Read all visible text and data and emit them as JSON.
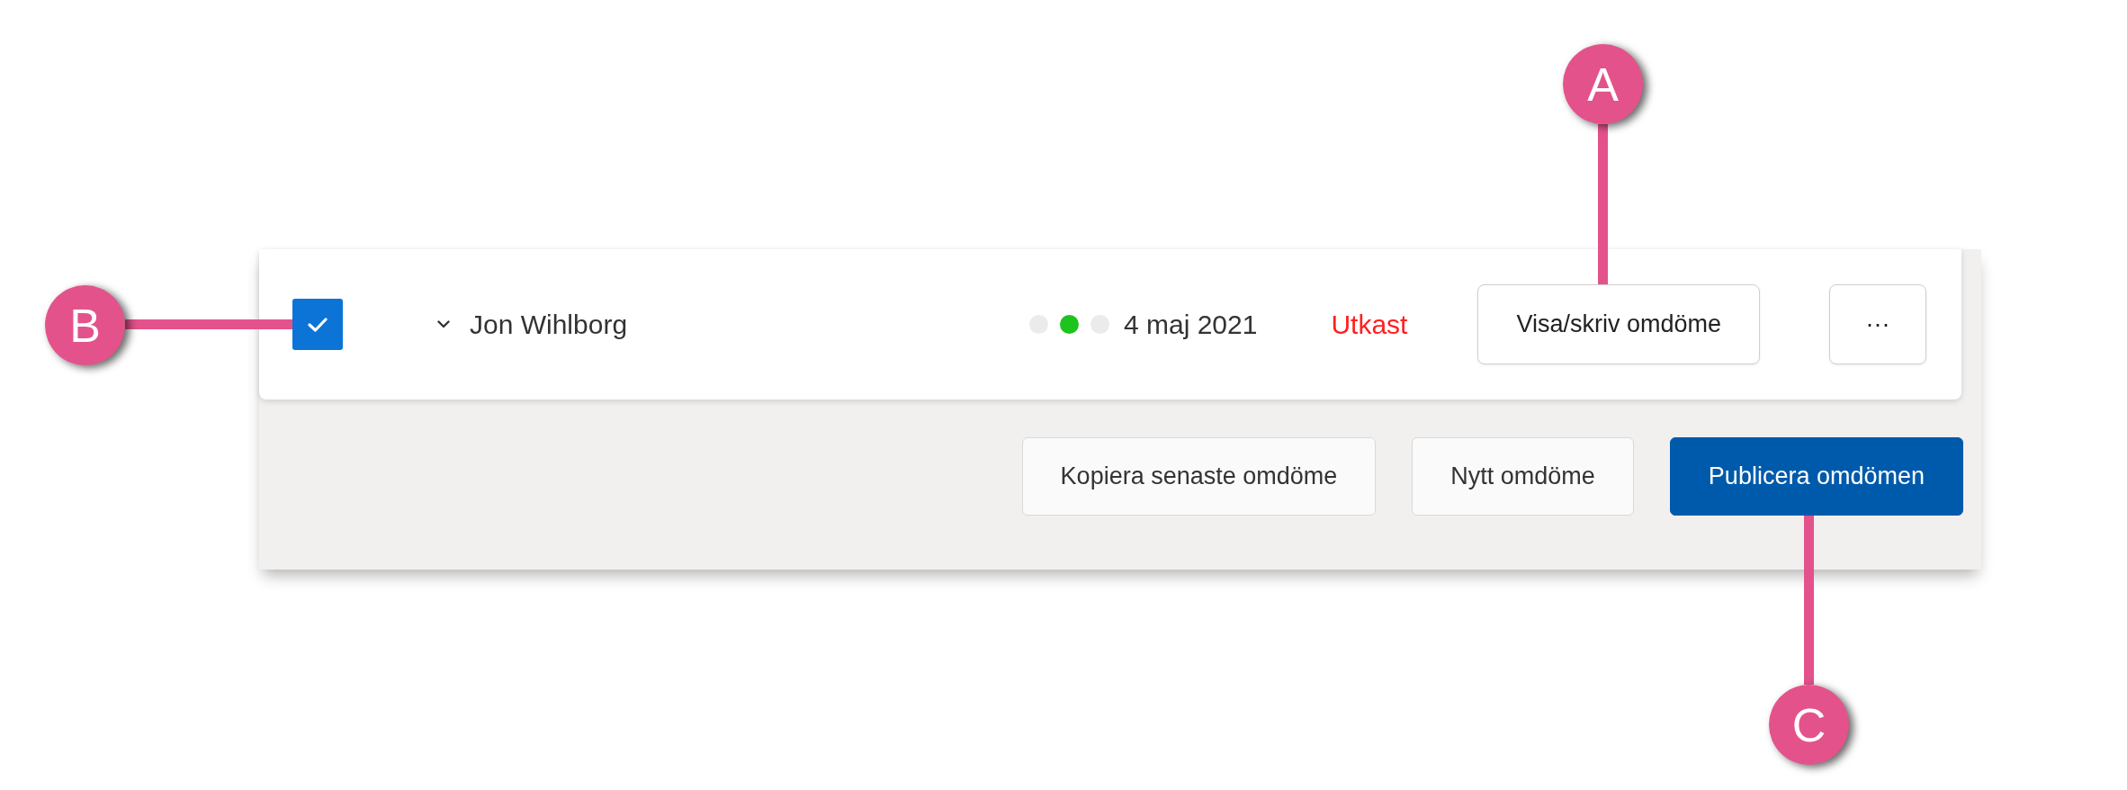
{
  "row": {
    "selected": true,
    "name": "Jon Wihlborg",
    "status_dots": [
      {
        "color": "#ebebeb"
      },
      {
        "color": "#1ec31e"
      },
      {
        "color": "#ebebeb"
      }
    ],
    "date": "4 maj 2021",
    "status": "Utkast",
    "view_button": "Visa/skriv omdöme",
    "more_button": "···"
  },
  "actions": [
    {
      "label": "Kopiera senaste omdöme",
      "kind": "secondary"
    },
    {
      "label": "Nytt omdöme",
      "kind": "secondary"
    },
    {
      "label": "Publicera omdömen",
      "kind": "primary"
    }
  ],
  "callouts": [
    {
      "label": "A"
    },
    {
      "label": "B"
    },
    {
      "label": "C"
    }
  ]
}
